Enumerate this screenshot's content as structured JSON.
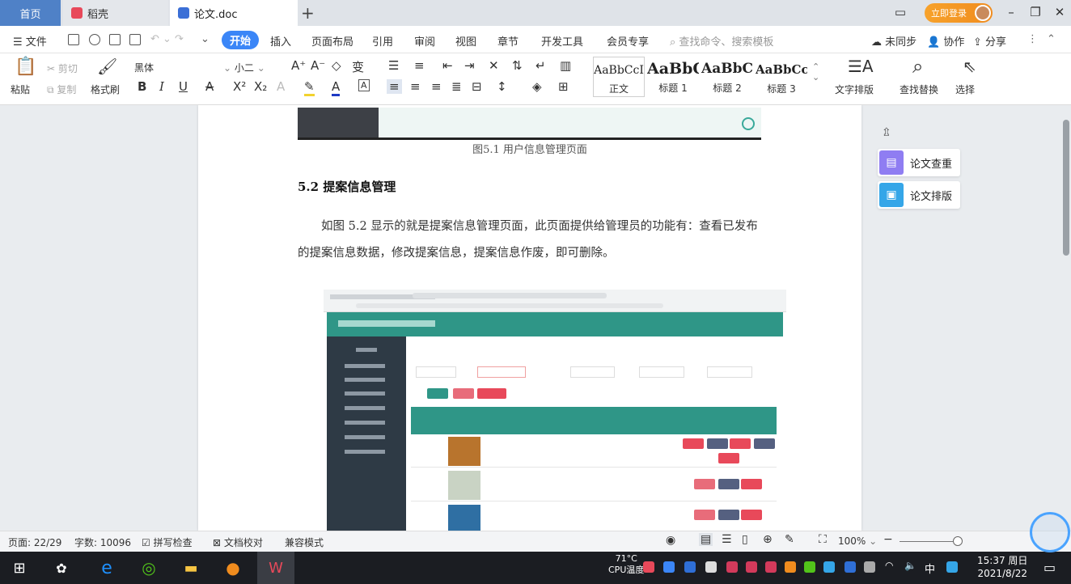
{
  "titlebar": {
    "tabs": [
      {
        "label": "首页"
      },
      {
        "label": "稻壳"
      },
      {
        "label": "论文.doc"
      }
    ],
    "new_tab": "+",
    "vip_label": "立即登录",
    "win_controls": {
      "layout": "▭",
      "minimize": "–",
      "restore": "❐",
      "close": "✕"
    }
  },
  "menubar": {
    "file": "文件",
    "items": [
      "开始",
      "插入",
      "页面布局",
      "引用",
      "审阅",
      "视图",
      "章节",
      "开发工具",
      "会员专享"
    ],
    "search_placeholder": "查找命令、搜索模板",
    "sync": "未同步",
    "collab": "协作",
    "share": "分享"
  },
  "ribbon": {
    "paste": "粘贴",
    "cut": "剪切",
    "copy": "复制",
    "format_painter": "格式刷",
    "font_name": "黑体",
    "font_size": "小二",
    "styles": [
      {
        "sample": "AaBbCcI",
        "label": "正文"
      },
      {
        "sample": "AaBbC",
        "label": "标题 1"
      },
      {
        "sample": "AaBbC",
        "label": "标题 2"
      },
      {
        "sample": "AaBbCcl",
        "label": "标题 3"
      }
    ],
    "text_layout": "文字排版",
    "find_replace": "查找替换",
    "select": "选择"
  },
  "document": {
    "figure_caption": "图5.1 用户信息管理页面",
    "section_heading": "5.2  提案信息管理",
    "paragraph": "如图 5.2 显示的就是提案信息管理页面，此页面提供给管理员的功能有：查看已发布的提案信息数据，修改提案信息，提案信息作废，即可删除。"
  },
  "side_panel": {
    "check": "论文查重",
    "layout": "论文排版"
  },
  "statusbar": {
    "page": "页面: 22/29",
    "words": "字数: 10096",
    "spell": "拼写检查",
    "proof": "文档校对",
    "compat": "兼容模式",
    "zoom": "100%"
  },
  "taskbar": {
    "tray_label": "CPU温度",
    "tray_value": "71°C",
    "ime": "中",
    "time": "15:37 周日",
    "date": "2021/8/22"
  },
  "colors": {
    "accent": "#3b86f7",
    "teal": "#2f9687",
    "home_tab": "#4f81c7"
  }
}
